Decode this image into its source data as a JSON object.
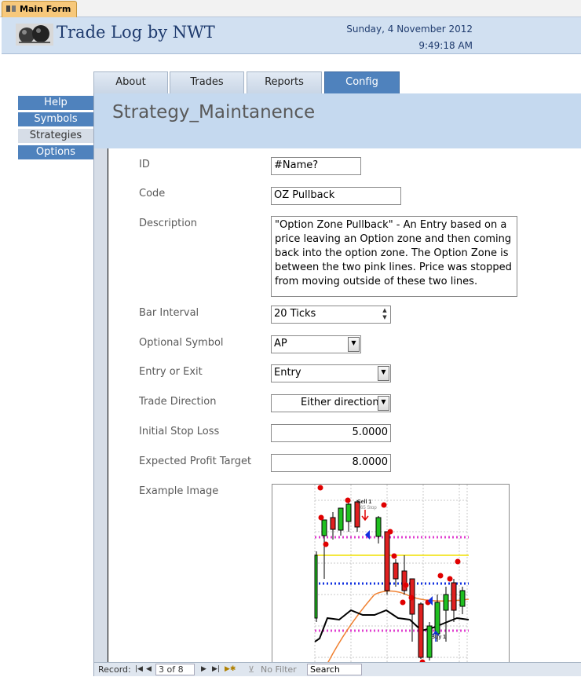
{
  "doc_tab": {
    "label": "Main Form"
  },
  "header": {
    "title": "Trade Log by NWT",
    "date": "Sunday, 4 November 2012",
    "time": "9:49:18 AM"
  },
  "tabs": [
    {
      "label": "About"
    },
    {
      "label": "Trades"
    },
    {
      "label": "Reports"
    },
    {
      "label": "Config",
      "active": true
    }
  ],
  "nav": [
    {
      "label": "Help"
    },
    {
      "label": "Symbols"
    },
    {
      "label": "Strategies",
      "selected": true
    },
    {
      "label": "Options"
    }
  ],
  "form": {
    "title": "Strategy_Maintanence",
    "fields": {
      "id": {
        "label": "ID",
        "value": "#Name?"
      },
      "code": {
        "label": "Code",
        "value": "OZ Pullback"
      },
      "description": {
        "label": "Description",
        "value": "\"Option Zone Pullback\" - An Entry based on a price leaving an Option zone and then coming back into the option zone. The Option Zone is between the two pink lines. Price was stopped from moving outside of these two lines."
      },
      "bar_interval": {
        "label": "Bar Interval",
        "value": "20 Ticks"
      },
      "optional_symbol": {
        "label": "Optional Symbol",
        "value": "AP"
      },
      "entry_or_exit": {
        "label": "Entry or Exit",
        "value": "Entry"
      },
      "trade_direction": {
        "label": "Trade Direction",
        "value": "Either direction"
      },
      "initial_stop_loss": {
        "label": "Initial Stop Loss",
        "value": "5.0000"
      },
      "expected_profit_target": {
        "label": "Expected Profit Target",
        "value": "8.0000"
      },
      "example_image": {
        "label": "Example Image"
      }
    },
    "image_annotations": {
      "sell": "Sell 1",
      "sell_stop": "65 Stop",
      "buy": "Buy 1"
    }
  },
  "record_nav": {
    "record_label": "Record:",
    "position": "3 of 8",
    "filter": "No Filter",
    "search_placeholder": "Search"
  },
  "colors": {
    "accent": "#4f82bd",
    "header_bg": "#d1e0f1",
    "form_header_bg": "#c5d9ef",
    "doc_tab": "#f7c87b"
  }
}
